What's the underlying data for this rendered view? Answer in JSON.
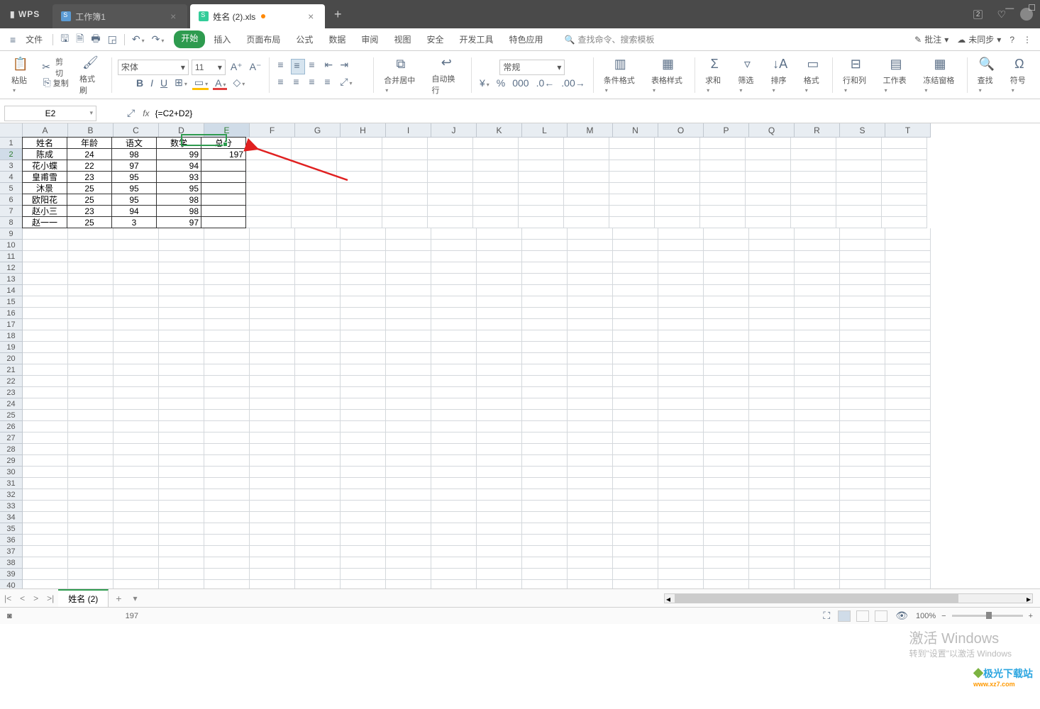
{
  "titlebar": {
    "app": "WPS",
    "tabs": [
      {
        "label": "工作簿1",
        "active": false
      },
      {
        "label": "姓名 (2).xls",
        "active": true
      }
    ],
    "badge": "2"
  },
  "menu": {
    "file": "文件",
    "tabs": [
      "开始",
      "插入",
      "页面布局",
      "公式",
      "数据",
      "审阅",
      "视图",
      "安全",
      "开发工具",
      "特色应用"
    ],
    "current": "开始",
    "search_placeholder": "查找命令、搜索模板",
    "annotate": "批注",
    "sync": "未同步"
  },
  "ribbon": {
    "paste": "粘贴",
    "cut": "剪切",
    "copy": "复制",
    "format_painter": "格式刷",
    "font_name": "宋体",
    "font_size": "11",
    "merge": "合并居中",
    "wrap": "自动换行",
    "num_format": "常规",
    "cond_fmt": "条件格式",
    "table_style": "表格样式",
    "sum": "求和",
    "filter": "筛选",
    "sort": "排序",
    "format": "格式",
    "rowcol": "行和列",
    "worksheet": "工作表",
    "freeze": "冻结窗格",
    "find": "查找",
    "symbol": "符号"
  },
  "formula_bar": {
    "cell_ref": "E2",
    "formula": "{=C2+D2}"
  },
  "grid": {
    "col_widths": {
      "A": 64,
      "B": 64,
      "C": 64,
      "D": 64,
      "E": 64,
      "default": 64
    },
    "columns": [
      "A",
      "B",
      "C",
      "D",
      "E",
      "F",
      "G",
      "H",
      "I",
      "J",
      "K",
      "L",
      "M",
      "N",
      "O",
      "P",
      "Q",
      "R",
      "S",
      "T"
    ],
    "headers": [
      "姓名",
      "年龄",
      "语文",
      "数学",
      "总分"
    ],
    "data": [
      [
        "陈成",
        "24",
        "98",
        "99",
        "197"
      ],
      [
        "花小蝶",
        "22",
        "97",
        "94",
        ""
      ],
      [
        "皇甫雪",
        "23",
        "95",
        "93",
        ""
      ],
      [
        "沐景",
        "25",
        "95",
        "95",
        ""
      ],
      [
        "欧阳花",
        "25",
        "95",
        "98",
        ""
      ],
      [
        "赵小三",
        "23",
        "94",
        "98",
        ""
      ],
      [
        "赵一一",
        "25",
        "3",
        "97",
        ""
      ]
    ],
    "selected": "E2"
  },
  "sheets": {
    "active": "姓名 (2)"
  },
  "status": {
    "value": "197",
    "zoom": "100%",
    "activate": "激活 Windows",
    "activate_sub": "转到\"设置\"以激活 Windows"
  },
  "logo": {
    "text": "极光下载站",
    "url": "www.xz7.com"
  }
}
